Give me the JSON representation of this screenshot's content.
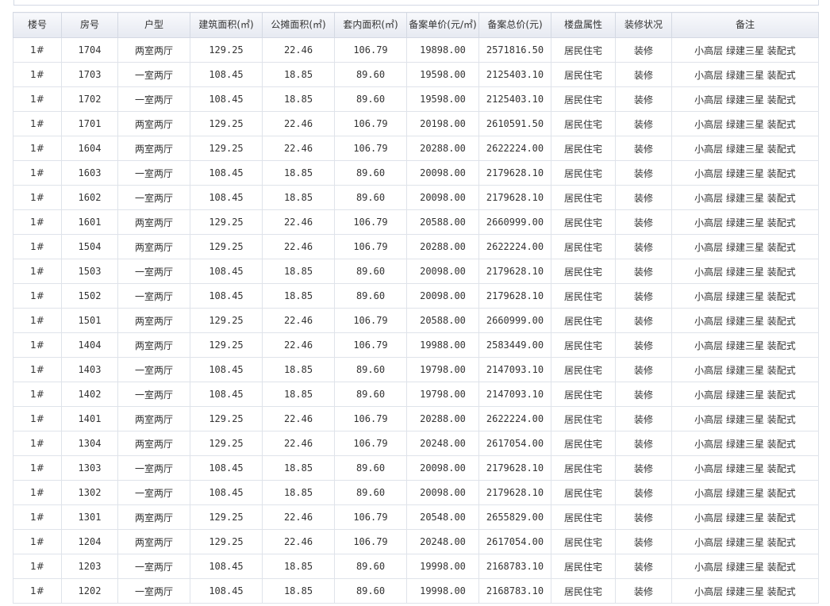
{
  "table": {
    "headers": [
      "楼号",
      "房号",
      "户型",
      "建筑面积(㎡)",
      "公摊面积(㎡)",
      "套内面积(㎡)",
      "备案单价(元/㎡)",
      "备案总价(元)",
      "楼盘属性",
      "装修状况",
      "备注"
    ],
    "rows": [
      [
        "1#",
        "1704",
        "两室两厅",
        "129.25",
        "22.46",
        "106.79",
        "19898.00",
        "2571816.50",
        "居民住宅",
        "装修",
        "小高层 绿建三星 装配式"
      ],
      [
        "1#",
        "1703",
        "一室两厅",
        "108.45",
        "18.85",
        "89.60",
        "19598.00",
        "2125403.10",
        "居民住宅",
        "装修",
        "小高层 绿建三星 装配式"
      ],
      [
        "1#",
        "1702",
        "一室两厅",
        "108.45",
        "18.85",
        "89.60",
        "19598.00",
        "2125403.10",
        "居民住宅",
        "装修",
        "小高层 绿建三星 装配式"
      ],
      [
        "1#",
        "1701",
        "两室两厅",
        "129.25",
        "22.46",
        "106.79",
        "20198.00",
        "2610591.50",
        "居民住宅",
        "装修",
        "小高层 绿建三星 装配式"
      ],
      [
        "1#",
        "1604",
        "两室两厅",
        "129.25",
        "22.46",
        "106.79",
        "20288.00",
        "2622224.00",
        "居民住宅",
        "装修",
        "小高层 绿建三星 装配式"
      ],
      [
        "1#",
        "1603",
        "一室两厅",
        "108.45",
        "18.85",
        "89.60",
        "20098.00",
        "2179628.10",
        "居民住宅",
        "装修",
        "小高层 绿建三星 装配式"
      ],
      [
        "1#",
        "1602",
        "一室两厅",
        "108.45",
        "18.85",
        "89.60",
        "20098.00",
        "2179628.10",
        "居民住宅",
        "装修",
        "小高层 绿建三星 装配式"
      ],
      [
        "1#",
        "1601",
        "两室两厅",
        "129.25",
        "22.46",
        "106.79",
        "20588.00",
        "2660999.00",
        "居民住宅",
        "装修",
        "小高层 绿建三星 装配式"
      ],
      [
        "1#",
        "1504",
        "两室两厅",
        "129.25",
        "22.46",
        "106.79",
        "20288.00",
        "2622224.00",
        "居民住宅",
        "装修",
        "小高层 绿建三星 装配式"
      ],
      [
        "1#",
        "1503",
        "一室两厅",
        "108.45",
        "18.85",
        "89.60",
        "20098.00",
        "2179628.10",
        "居民住宅",
        "装修",
        "小高层 绿建三星 装配式"
      ],
      [
        "1#",
        "1502",
        "一室两厅",
        "108.45",
        "18.85",
        "89.60",
        "20098.00",
        "2179628.10",
        "居民住宅",
        "装修",
        "小高层 绿建三星 装配式"
      ],
      [
        "1#",
        "1501",
        "两室两厅",
        "129.25",
        "22.46",
        "106.79",
        "20588.00",
        "2660999.00",
        "居民住宅",
        "装修",
        "小高层 绿建三星 装配式"
      ],
      [
        "1#",
        "1404",
        "两室两厅",
        "129.25",
        "22.46",
        "106.79",
        "19988.00",
        "2583449.00",
        "居民住宅",
        "装修",
        "小高层 绿建三星 装配式"
      ],
      [
        "1#",
        "1403",
        "一室两厅",
        "108.45",
        "18.85",
        "89.60",
        "19798.00",
        "2147093.10",
        "居民住宅",
        "装修",
        "小高层 绿建三星 装配式"
      ],
      [
        "1#",
        "1402",
        "一室两厅",
        "108.45",
        "18.85",
        "89.60",
        "19798.00",
        "2147093.10",
        "居民住宅",
        "装修",
        "小高层 绿建三星 装配式"
      ],
      [
        "1#",
        "1401",
        "两室两厅",
        "129.25",
        "22.46",
        "106.79",
        "20288.00",
        "2622224.00",
        "居民住宅",
        "装修",
        "小高层 绿建三星 装配式"
      ],
      [
        "1#",
        "1304",
        "两室两厅",
        "129.25",
        "22.46",
        "106.79",
        "20248.00",
        "2617054.00",
        "居民住宅",
        "装修",
        "小高层 绿建三星 装配式"
      ],
      [
        "1#",
        "1303",
        "一室两厅",
        "108.45",
        "18.85",
        "89.60",
        "20098.00",
        "2179628.10",
        "居民住宅",
        "装修",
        "小高层 绿建三星 装配式"
      ],
      [
        "1#",
        "1302",
        "一室两厅",
        "108.45",
        "18.85",
        "89.60",
        "20098.00",
        "2179628.10",
        "居民住宅",
        "装修",
        "小高层 绿建三星 装配式"
      ],
      [
        "1#",
        "1301",
        "两室两厅",
        "129.25",
        "22.46",
        "106.79",
        "20548.00",
        "2655829.00",
        "居民住宅",
        "装修",
        "小高层 绿建三星 装配式"
      ],
      [
        "1#",
        "1204",
        "两室两厅",
        "129.25",
        "22.46",
        "106.79",
        "20248.00",
        "2617054.00",
        "居民住宅",
        "装修",
        "小高层 绿建三星 装配式"
      ],
      [
        "1#",
        "1203",
        "一室两厅",
        "108.45",
        "18.85",
        "89.60",
        "19998.00",
        "2168783.10",
        "居民住宅",
        "装修",
        "小高层 绿建三星 装配式"
      ],
      [
        "1#",
        "1202",
        "一室两厅",
        "108.45",
        "18.85",
        "89.60",
        "19998.00",
        "2168783.10",
        "居民住宅",
        "装修",
        "小高层 绿建三星 装配式"
      ]
    ]
  }
}
